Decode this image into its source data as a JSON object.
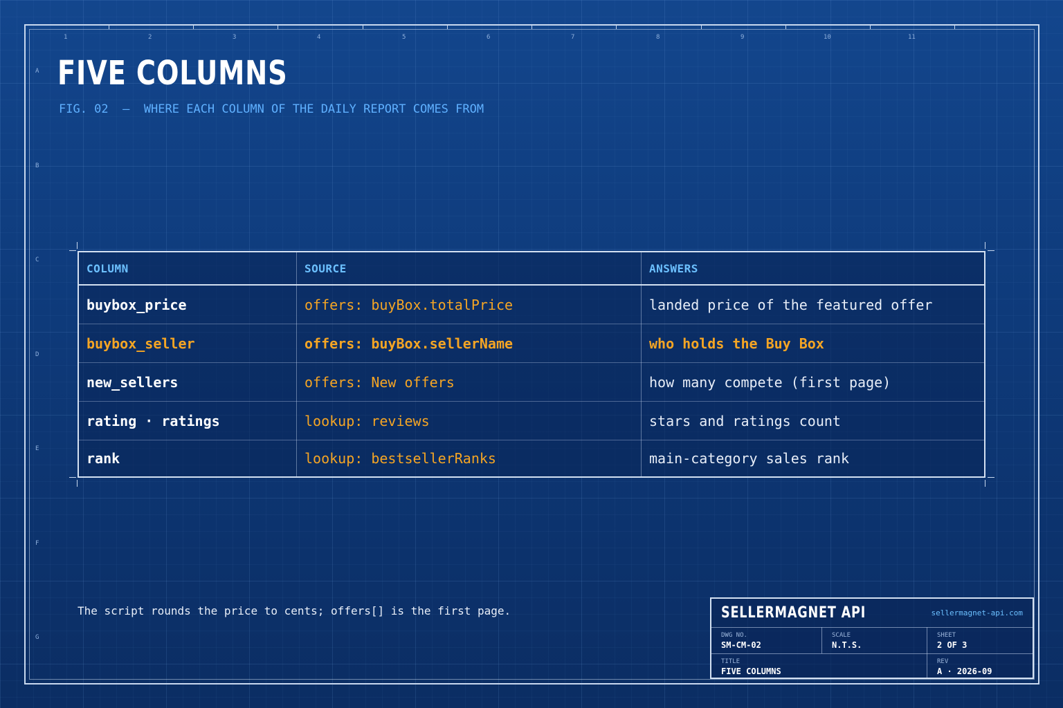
{
  "drawing": {
    "title": "FIVE COLUMNS",
    "subtitle": "FIG. 02  —  WHERE EACH COLUMN OF THE DAILY REPORT COMES FROM",
    "column_numbers": [
      "1",
      "2",
      "3",
      "4",
      "5",
      "6",
      "7",
      "8",
      "9",
      "10",
      "11"
    ],
    "row_letters": [
      "A",
      "B",
      "C",
      "D",
      "E",
      "F",
      "G"
    ]
  },
  "table": {
    "headers": [
      "COLUMN",
      "SOURCE",
      "ANSWERS"
    ],
    "rows": [
      {
        "column": "buybox_price",
        "source": "offers: buyBox.totalPrice",
        "answers": "landed price of the featured offer",
        "highlight": false
      },
      {
        "column": "buybox_seller",
        "source": "offers: buyBox.sellerName",
        "answers": "who holds the Buy Box",
        "highlight": true
      },
      {
        "column": "new_sellers",
        "source": "offers: New offers",
        "answers": "how many compete (first page)",
        "highlight": false
      },
      {
        "column": "rating · ratings",
        "source": "lookup: reviews",
        "answers": "stars and ratings count",
        "highlight": false
      },
      {
        "column": "rank",
        "source": "lookup: bestsellerRanks",
        "answers": "main-category sales rank",
        "highlight": false
      }
    ]
  },
  "note": "The script rounds the price to cents; offers[] is the first page.",
  "title_block": {
    "brand": "SELLERMAGNET API",
    "url": "sellermagnet-api.com",
    "dwg_no_label": "DWG NO.",
    "dwg_no": "SM-CM-02",
    "scale_label": "SCALE",
    "scale": "N.T.S.",
    "sheet_label": "SHEET",
    "sheet": "2 OF 3",
    "title_label": "TITLE",
    "title": "FIVE COLUMNS",
    "rev_label": "REV",
    "rev": "A · 2026-09"
  },
  "colors": {
    "background": "#0e3a7a",
    "accent_orange": "#f5a524",
    "accent_blue": "#5fb0ff",
    "line": "#d4e1f2"
  }
}
